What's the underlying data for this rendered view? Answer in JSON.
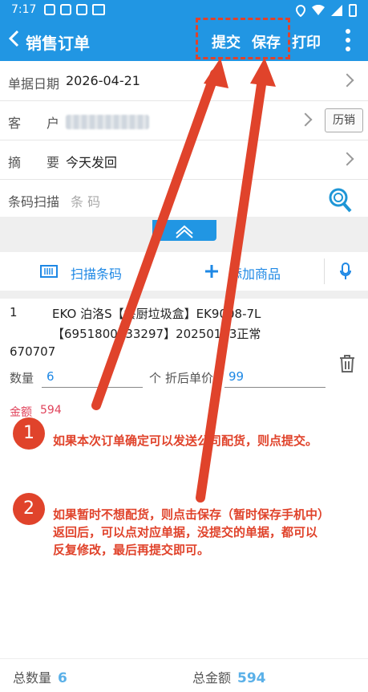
{
  "status_bar": {
    "time": "7:17"
  },
  "app_bar": {
    "title": "销售订单",
    "submit": "提交",
    "save": "保存",
    "print": "打印"
  },
  "form": {
    "date_label": "单据日期",
    "date_value": "2026-04-21",
    "customer_label": "客　　户",
    "history_button": "历销",
    "summary_label": "摘　　要",
    "summary_value": "今天发回",
    "barcode_label": "条码扫描",
    "barcode_placeholder": "条 码"
  },
  "toolbar": {
    "scan": "扫描条码",
    "add": "添加商品"
  },
  "item": {
    "index": "1",
    "name_line1": "EKO 泊洛S【餐厨垃圾盒】EK9008-7L",
    "name_line2": "【6951800033297】20250103正常",
    "code": "670707",
    "qty_label": "数量",
    "qty_value": "6",
    "unit": "个",
    "price_label": "折后单价",
    "price_value": "99",
    "amount_label": "金额",
    "amount_value": "594"
  },
  "notes": [
    {
      "num": "1",
      "text": "如果本次订单确定可以发送公司配货，则点提交。"
    },
    {
      "num": "2",
      "lines": [
        "如果暂时不想配货，则点击保存（暂时保存手机中）",
        "返回后，可以点对应单据，没提交的单据，都可以",
        "反复修改，最后再提交即可。"
      ]
    }
  ],
  "footer": {
    "qty_label": "总数量",
    "qty_value": "6",
    "amount_label": "总金额",
    "amount_value": "594"
  },
  "colors": {
    "primary": "#2196e3",
    "annotation": "#e0432b",
    "amount": "#e0435b"
  }
}
